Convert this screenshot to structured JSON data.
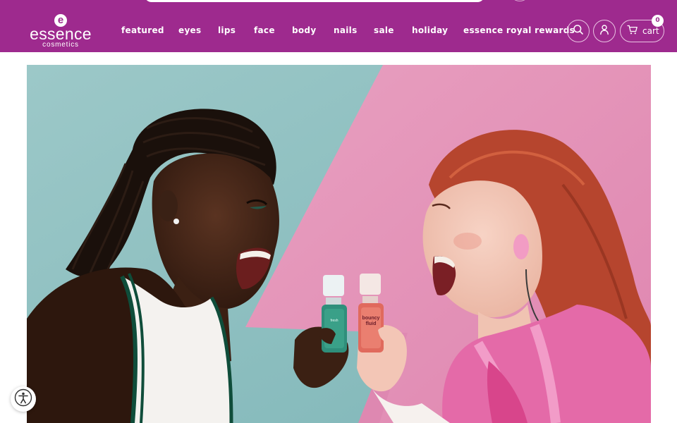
{
  "brand": {
    "mark": "e",
    "name": "essence",
    "sub": "cosmetics",
    "color": "#9e2a8e"
  },
  "nav": {
    "items": [
      {
        "label": "featured"
      },
      {
        "label": "eyes"
      },
      {
        "label": "lips"
      },
      {
        "label": "face"
      },
      {
        "label": "body"
      },
      {
        "label": "nails"
      },
      {
        "label": "sale"
      },
      {
        "label": "holiday"
      },
      {
        "label": "essence royal rewards"
      }
    ]
  },
  "actions": {
    "search_icon": "search-icon",
    "account_icon": "user-icon",
    "cart_icon": "cart-icon",
    "cart_label": "cart",
    "cart_count": "0"
  },
  "hero": {
    "left_bottle_label": "fresh",
    "right_bottle_label": "bouncy fluid",
    "colors": {
      "teal_bg": "#8fc1c2",
      "pink_bg": "#e58fb6",
      "jacket": "#e46aa8"
    }
  },
  "accessibility": {
    "icon": "accessibility-icon"
  }
}
